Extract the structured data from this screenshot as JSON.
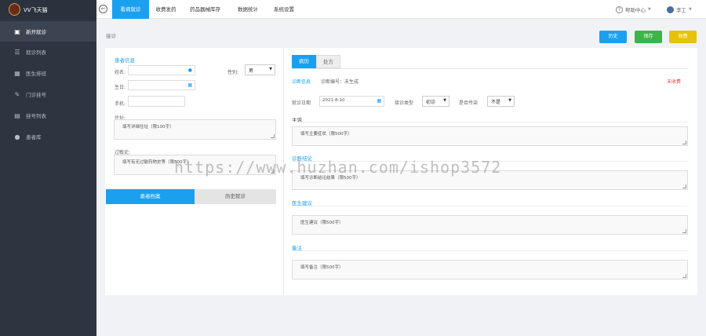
{
  "app": {
    "title": "VV飞天猫"
  },
  "nav": {
    "items": [
      {
        "label": "看病就诊",
        "active": true
      },
      {
        "label": "收费发药",
        "active": false
      },
      {
        "label": "药品器械库存",
        "active": false
      },
      {
        "label": "数据统计",
        "active": false
      },
      {
        "label": "系统设置",
        "active": false
      }
    ]
  },
  "header": {
    "help_label": "帮助中心",
    "user_name": "李工"
  },
  "sidebar": {
    "items": [
      {
        "label": "新开就诊",
        "icon": "camera-icon",
        "active": true
      },
      {
        "label": "就诊列表",
        "icon": "list-icon",
        "active": false
      },
      {
        "label": "医生排班",
        "icon": "calendar-icon",
        "active": false
      },
      {
        "label": "门诊挂号",
        "icon": "register-icon",
        "active": false
      },
      {
        "label": "挂号列表",
        "icon": "card-icon",
        "active": false
      },
      {
        "label": "患者库",
        "icon": "user-icon",
        "active": false
      }
    ]
  },
  "breadcrumb": "接诊",
  "actions": {
    "history": "历史",
    "save": "保存",
    "pay": "收费"
  },
  "patient": {
    "section_title": "患者信息",
    "name_label": "姓名:",
    "gender_label": "性别:",
    "gender_value": "男",
    "birth_label": "生日:",
    "phone_label": "手机:",
    "address_label": "住址:",
    "address_placeholder": "填写详细住址（限100字）",
    "allergy_label": "过敏史:",
    "allergy_placeholder": "填写有无过敏药物史等（限500字）"
  },
  "left_tabs": {
    "select": "患者档案",
    "history": "历史就诊"
  },
  "record": {
    "tab_record": "病历",
    "tab_prescription": "处方",
    "diag_info": "诊断信息",
    "diag_no": "诊断编号：未生成",
    "status": "未收费",
    "visit_date_label": "就诊日期",
    "visit_date_value": "2021-8-10",
    "visit_type_label": "接诊类型",
    "visit_type_value": "初诊",
    "infectious_label": "是否传染",
    "infectious_value": "不是",
    "complaint_label": "主诉",
    "complaint_placeholder": "填写主要症状（限500字）",
    "diagnosis_label": "诊断结论",
    "diagnosis_placeholder": "填写诊断结论结果（限500字）",
    "advice_label": "医生建议",
    "advice_placeholder": "医生建议（限500字）",
    "remark_label": "备注",
    "remark_placeholder": "填写备注（限500字）"
  },
  "watermark": "https://www.huzhan.com/ishop3572",
  "colors": {
    "accent": "#1aa0ef",
    "sidebar": "#2e3440",
    "success": "#3bb54a",
    "warning": "#e6c20a",
    "danger": "#e0463c"
  }
}
